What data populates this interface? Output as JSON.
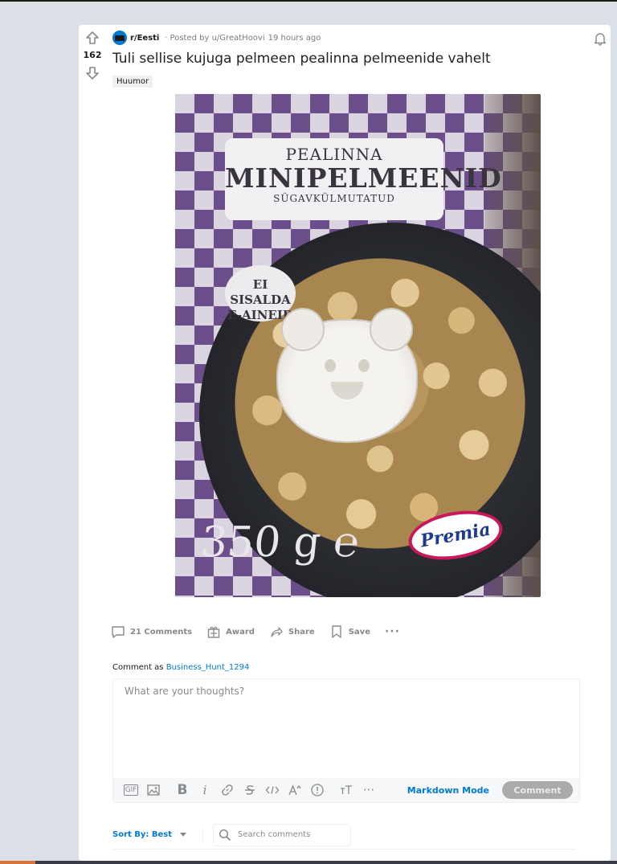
{
  "post": {
    "vote_count": "162",
    "subreddit": "r/Eesti",
    "posted_by": "Posted by u/GreatHoovi",
    "time_ago": "19 hours ago",
    "title": "Tuli sellise kujuga pelmeen pealinna pelmeenide vahelt",
    "flair": "Huumor"
  },
  "image_text": {
    "label_line1": "PEALINNA",
    "label_line2": "MINIPELMEENID",
    "label_line3": "SÜGAVKÜLMUTATUD",
    "badge_line1": "EI SISALDA",
    "badge_line2": "E-AINEID",
    "weight": "350 g ℮",
    "brand": "Premia"
  },
  "actions": {
    "comments": "21 Comments",
    "award": "Award",
    "share": "Share",
    "save": "Save",
    "more": "···"
  },
  "comment_box": {
    "comment_as_label": "Comment as",
    "username": "Business_Hunt_1294",
    "placeholder": "What are your thoughts?",
    "markdown_mode": "Markdown Mode",
    "submit": "Comment",
    "gif_label": "GIF",
    "more": "···"
  },
  "sort": {
    "label": "Sort By: Best",
    "search_placeholder": "Search comments"
  },
  "colors": {
    "accent": "#0079d3",
    "page_bg": "#dae0e6",
    "muted": "#878a8c"
  },
  "icons": [
    "upvote-icon",
    "downvote-icon",
    "bell-icon",
    "comment-icon",
    "award-icon",
    "share-icon",
    "save-icon",
    "search-icon"
  ]
}
